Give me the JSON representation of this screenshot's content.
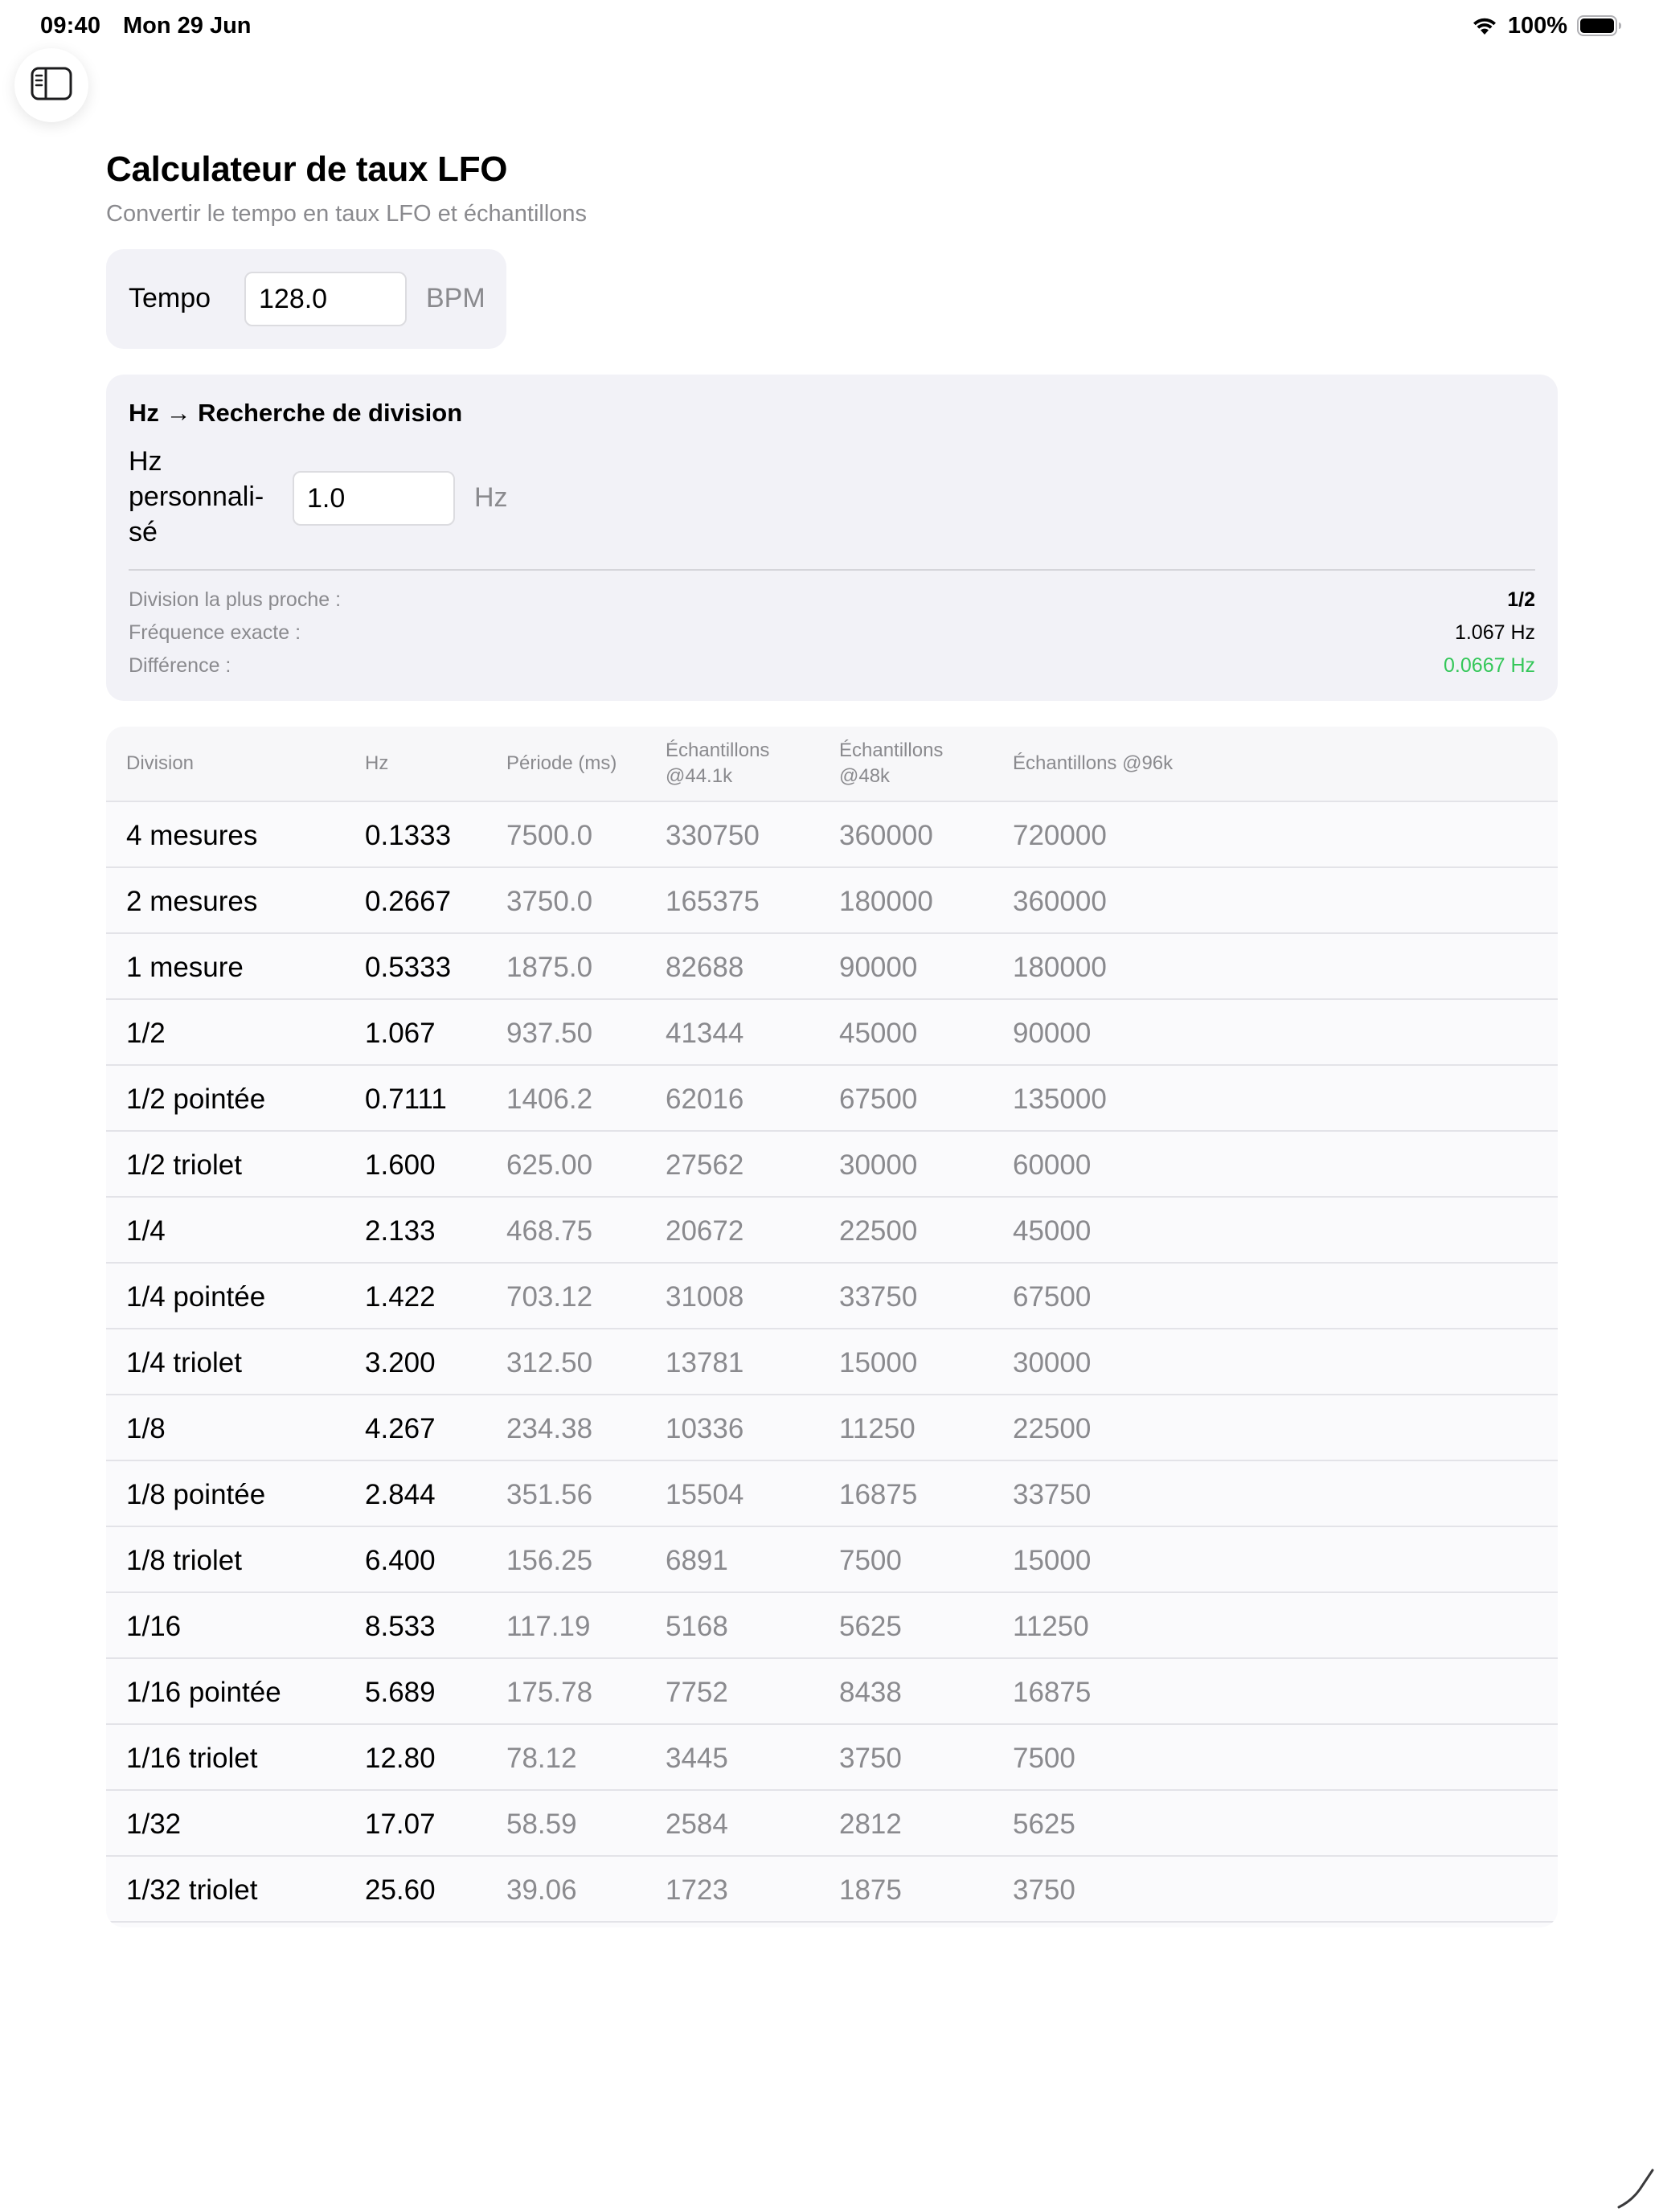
{
  "status_bar": {
    "time": "09:40",
    "date": "Mon 29 Jun",
    "battery": "100%"
  },
  "header": {
    "title": "Calculateur de taux LFO",
    "subtitle": "Convertir le tempo en taux LFO et échantillons"
  },
  "tempo": {
    "label": "Tempo",
    "value": "128.0",
    "unit": "BPM"
  },
  "lookup": {
    "title": "Hz → Recherche de division",
    "hz_label": "Hz personnali-sé",
    "hz_value": "1.0",
    "hz_unit": "Hz",
    "nearest_label": "Division la plus proche :",
    "nearest_value": "1/2",
    "exact_label": "Fréquence exacte :",
    "exact_value": "1.067 Hz",
    "diff_label": "Différence :",
    "diff_value": "0.0667 Hz",
    "diff_color": "#34c759"
  },
  "table": {
    "headers": {
      "division": "Division",
      "hz": "Hz",
      "period": "Période (ms)",
      "s441": "Échantillons @44.1k",
      "s48": "Échantillons @48k",
      "s96": "Échantillons @96k"
    },
    "rows": [
      {
        "division": "4 mesures",
        "hz": "0.1333",
        "period": "7500.0",
        "s441": "330750",
        "s48": "360000",
        "s96": "720000"
      },
      {
        "division": "2 mesures",
        "hz": "0.2667",
        "period": "3750.0",
        "s441": "165375",
        "s48": "180000",
        "s96": "360000"
      },
      {
        "division": "1 mesure",
        "hz": "0.5333",
        "period": "1875.0",
        "s441": "82688",
        "s48": "90000",
        "s96": "180000"
      },
      {
        "division": "1/2",
        "hz": "1.067",
        "period": "937.50",
        "s441": "41344",
        "s48": "45000",
        "s96": "90000"
      },
      {
        "division": "1/2 pointée",
        "hz": "0.7111",
        "period": "1406.2",
        "s441": "62016",
        "s48": "67500",
        "s96": "135000"
      },
      {
        "division": "1/2 triolet",
        "hz": "1.600",
        "period": "625.00",
        "s441": "27562",
        "s48": "30000",
        "s96": "60000"
      },
      {
        "division": "1/4",
        "hz": "2.133",
        "period": "468.75",
        "s441": "20672",
        "s48": "22500",
        "s96": "45000"
      },
      {
        "division": "1/4 pointée",
        "hz": "1.422",
        "period": "703.12",
        "s441": "31008",
        "s48": "33750",
        "s96": "67500"
      },
      {
        "division": "1/4 triolet",
        "hz": "3.200",
        "period": "312.50",
        "s441": "13781",
        "s48": "15000",
        "s96": "30000"
      },
      {
        "division": "1/8",
        "hz": "4.267",
        "period": "234.38",
        "s441": "10336",
        "s48": "11250",
        "s96": "22500"
      },
      {
        "division": "1/8 pointée",
        "hz": "2.844",
        "period": "351.56",
        "s441": "15504",
        "s48": "16875",
        "s96": "33750"
      },
      {
        "division": "1/8 triolet",
        "hz": "6.400",
        "period": "156.25",
        "s441": "6891",
        "s48": "7500",
        "s96": "15000"
      },
      {
        "division": "1/16",
        "hz": "8.533",
        "period": "117.19",
        "s441": "5168",
        "s48": "5625",
        "s96": "11250"
      },
      {
        "division": "1/16 pointée",
        "hz": "5.689",
        "period": "175.78",
        "s441": "7752",
        "s48": "8438",
        "s96": "16875"
      },
      {
        "division": "1/16 triolet",
        "hz": "12.80",
        "period": "78.12",
        "s441": "3445",
        "s48": "3750",
        "s96": "7500"
      },
      {
        "division": "1/32",
        "hz": "17.07",
        "period": "58.59",
        "s441": "2584",
        "s48": "2812",
        "s96": "5625"
      },
      {
        "division": "1/32 triolet",
        "hz": "25.60",
        "period": "39.06",
        "s441": "1723",
        "s48": "1875",
        "s96": "3750"
      }
    ]
  },
  "icons": {
    "sidebar_toggle": "sidebar-icon",
    "wifi": "wifi-icon",
    "battery": "battery-icon",
    "pencil": "pencil-icon"
  }
}
